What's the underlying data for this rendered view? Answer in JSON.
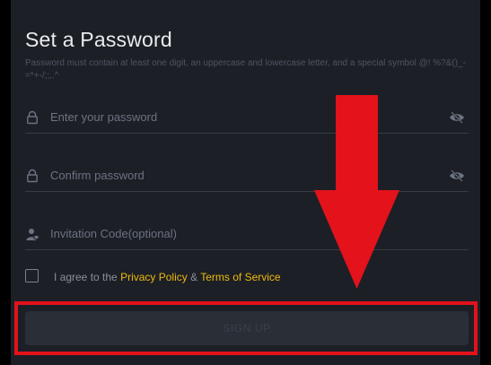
{
  "form": {
    "title": "Set a Password",
    "hint": "Password must contain at least one digit, an uppercase and lowercase letter, and a special symbol @! %?&()_-=*+-/;;,.^",
    "password": {
      "placeholder": "Enter your password",
      "icon": "lock-icon",
      "toggle_icon": "eye-off-icon"
    },
    "confirm": {
      "placeholder": "Confirm password",
      "icon": "lock-icon",
      "toggle_icon": "eye-off-icon"
    },
    "invitation": {
      "placeholder": "Invitation Code(optional)",
      "icon": "user-icon"
    },
    "agree": {
      "prefix": "I agree to the",
      "privacy_link": "Privacy Policy",
      "ampersand": "&",
      "terms_link": "Terms of Service",
      "checked": false
    },
    "signup_label": "SIGN UP"
  },
  "annotation": {
    "arrow_color": "#e3121b",
    "box_color": "#e3121b"
  },
  "colors": {
    "background": "#1c1f26",
    "accent": "#f0b90b",
    "button": "#2a2e36"
  }
}
